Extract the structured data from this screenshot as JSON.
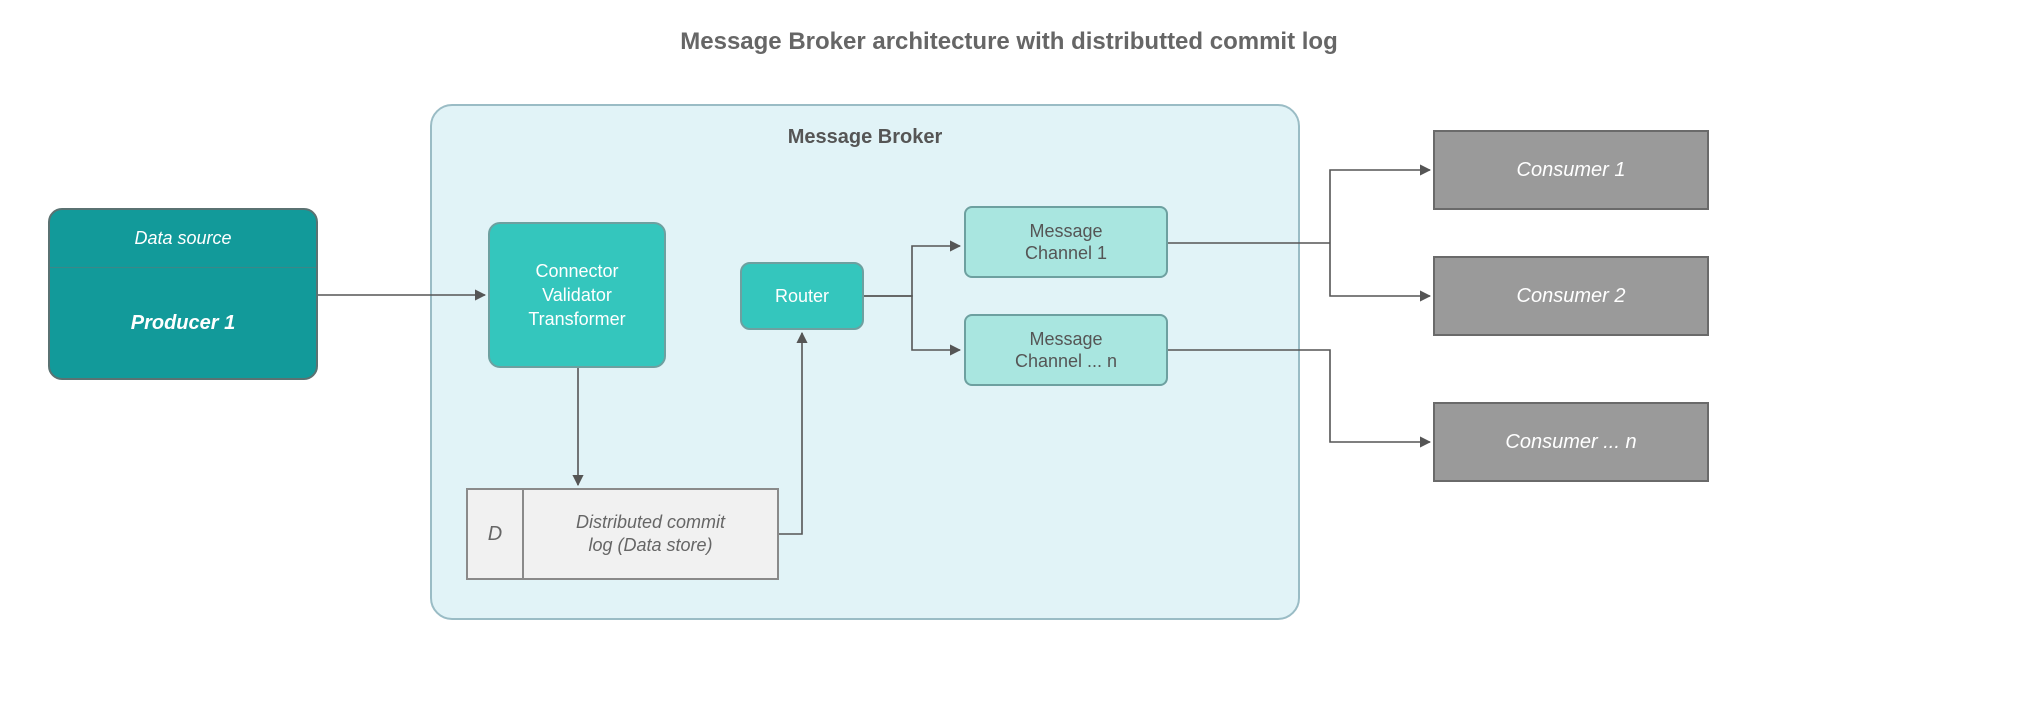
{
  "title": "Message Broker architecture with distributted commit log",
  "producer": {
    "data_source_label": "Data source",
    "producer_label": "Producer 1"
  },
  "broker": {
    "label": "Message Broker",
    "connector_label": "Connector\nValidator\nTransformer",
    "router_label": "Router",
    "channels": [
      {
        "label": "Message\nChannel 1"
      },
      {
        "label": "Message\nChannel ... n"
      }
    ],
    "datastore": {
      "tag": "D",
      "label": "Distributed commit\nlog (Data store)"
    }
  },
  "consumers": [
    {
      "label": "Consumer 1"
    },
    {
      "label": "Consumer 2"
    },
    {
      "label": "Consumer ... n"
    }
  ]
}
